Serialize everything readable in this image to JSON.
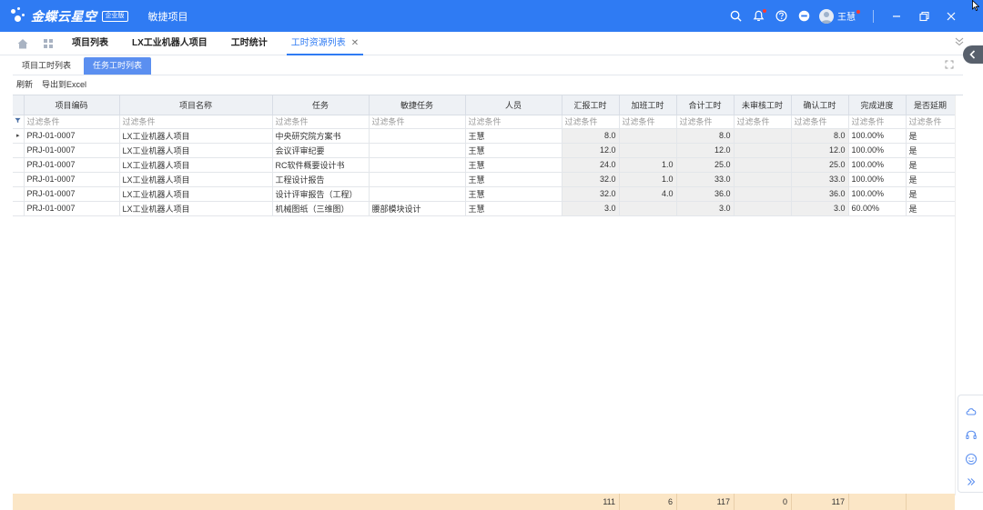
{
  "topbar": {
    "brand": "金蝶云星空",
    "badge": "企业版",
    "app_name": "敏捷项目",
    "user_name": "王慧",
    "colors": {
      "primary": "#2f7bf3",
      "notify": "#ff3b30"
    },
    "icons": [
      "search-icon",
      "bell-icon",
      "help-icon",
      "minus-circle-icon",
      "avatar",
      "minimize-icon",
      "restore-icon",
      "close-icon"
    ]
  },
  "tabs": [
    {
      "label": "项目列表"
    },
    {
      "label": "LX工业机器人项目"
    },
    {
      "label": "工时统计"
    },
    {
      "label": "工时资源列表",
      "close": "✕"
    }
  ],
  "subtabs": [
    {
      "label": "项目工时列表"
    },
    {
      "label": "任务工时列表"
    }
  ],
  "toolbar": {
    "refresh": "刷新",
    "export": "导出到Excel"
  },
  "grid": {
    "columns": [
      "项目编码",
      "项目名称",
      "任务",
      "敏捷任务",
      "人员",
      "汇报工时",
      "加班工时",
      "合计工时",
      "未审核工时",
      "确认工时",
      "完成进度",
      "是否延期"
    ],
    "filter_placeholder": "过滤条件",
    "rows": [
      [
        "PRJ-01-0007",
        "LX工业机器人项目",
        "中央研究院方案书",
        "",
        "王慧",
        "8.0",
        "",
        "8.0",
        "",
        "8.0",
        "100.00%",
        "是"
      ],
      [
        "PRJ-01-0007",
        "LX工业机器人项目",
        "会议评审纪要",
        "",
        "王慧",
        "12.0",
        "",
        "12.0",
        "",
        "12.0",
        "100.00%",
        "是"
      ],
      [
        "PRJ-01-0007",
        "LX工业机器人项目",
        "RC软件概要设计书",
        "",
        "王慧",
        "24.0",
        "1.0",
        "25.0",
        "",
        "25.0",
        "100.00%",
        "是"
      ],
      [
        "PRJ-01-0007",
        "LX工业机器人项目",
        "工程设计报告",
        "",
        "王慧",
        "32.0",
        "1.0",
        "33.0",
        "",
        "33.0",
        "100.00%",
        "是"
      ],
      [
        "PRJ-01-0007",
        "LX工业机器人项目",
        "设计评审报告（工程）",
        "",
        "王慧",
        "32.0",
        "4.0",
        "36.0",
        "",
        "36.0",
        "100.00%",
        "是"
      ],
      [
        "PRJ-01-0007",
        "LX工业机器人项目",
        "机械图纸（三维图）",
        "腰部模块设计",
        "王慧",
        "3.0",
        "",
        "3.0",
        "",
        "3.0",
        "60.00%",
        "是"
      ]
    ],
    "summary": {
      "reported": "111",
      "overtime": "6",
      "total": "117",
      "unaudited": "0",
      "confirmed": "117"
    }
  }
}
